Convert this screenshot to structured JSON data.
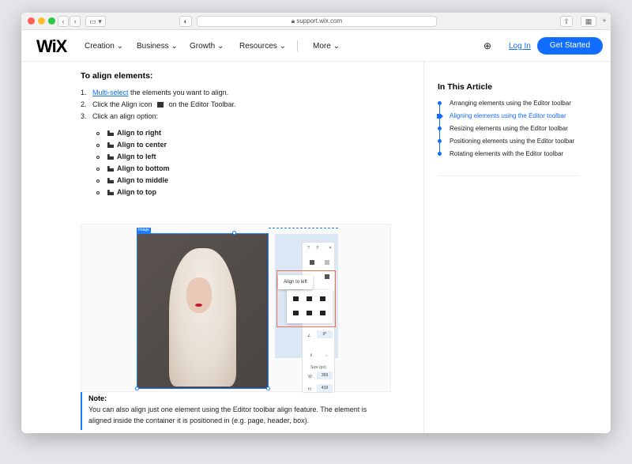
{
  "browser": {
    "url": "support.wix.com"
  },
  "nav": {
    "logo": "WiX",
    "items": [
      "Creation",
      "Business",
      "Growth",
      "Resources",
      "More"
    ],
    "login": "Log In",
    "cta": "Get Started"
  },
  "article": {
    "heading": "To align elements:",
    "steps": [
      {
        "num": "1.",
        "link": "Multi-select",
        "text": " the elements you want to align."
      },
      {
        "num": "2.",
        "text": "Click the Align icon",
        "text2": "on the Editor Toolbar."
      },
      {
        "num": "3.",
        "text": "Click an align option:"
      }
    ],
    "options": [
      "Align to right",
      "Align to center",
      "Align to left",
      "Align to bottom",
      "Align to middle",
      "Align to top"
    ],
    "illustration": {
      "element_tag": "Image",
      "tooltip": "Align to left",
      "size_label": "Size (px)",
      "width_label": "W:",
      "width_value": "359",
      "height_label": "H:",
      "height_value": "419",
      "rotation": "0°"
    },
    "note": {
      "title": "Note:",
      "body": "You can also align just one element using the Editor toolbar align feature. The element is aligned inside the container it is positioned in (e.g. page, header, box)."
    }
  },
  "sidebar": {
    "title": "In This Article",
    "items": [
      "Arranging elements using the Editor toolbar",
      "Aligning elements using the Editor toolbar",
      "Resizing elements using the Editor toolbar",
      "Positioning elements using the Editor toolbar",
      "Rotating elements with the Editor toolbar"
    ],
    "active_index": 1
  },
  "colors": {
    "accent": "#116dff",
    "highlight": "#f07051"
  }
}
